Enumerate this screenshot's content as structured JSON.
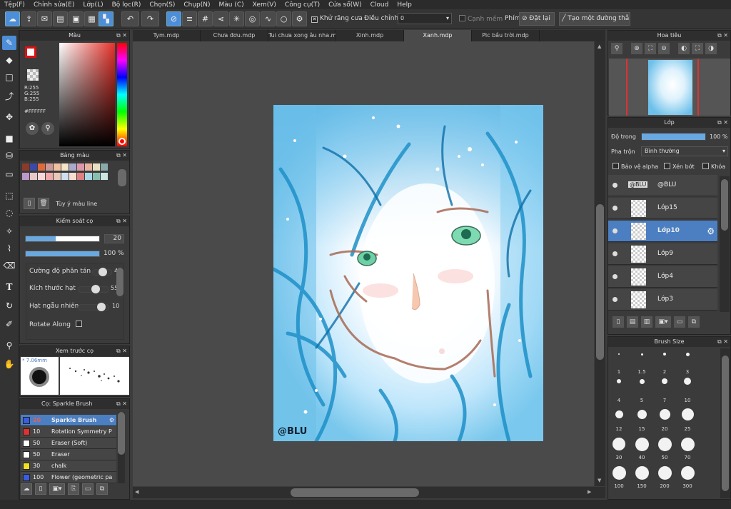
{
  "menu": [
    "Tệp(F)",
    "Chỉnh sửa(E)",
    "Lớp(L)",
    "Bộ lọc(R)",
    "Chọn(S)",
    "Chụp(N)",
    "Màu (C)",
    "Xem(V)",
    "Công cụ(T)",
    "Cửa sổ(W)",
    "Cloud",
    "Help"
  ],
  "toolbar": {
    "antialias_label": "Khử răng cưa",
    "adjust_label": "Điều chỉnh",
    "adjust_value": "0",
    "soft_edge_label": "Cạnh mềm",
    "key_label": "Phím",
    "reset_label": "Đặt lại",
    "create_line_label": "Tạo một đường thẳng"
  },
  "tabs": [
    "Tym.mdp",
    "Chưa đơu.mdp",
    "Tui chưa xong âu nha.mdp",
    "Xinh.mdp",
    "Xanh.mdp",
    "Pic bầu trời.mdp"
  ],
  "active_tab": 4,
  "color_panel": {
    "title": "Màu",
    "rgb_r": "R:255",
    "rgb_g": "G:255",
    "rgb_b": "B:255",
    "hex": "#FFFFFF"
  },
  "palette_panel": {
    "title": "Bảng màu",
    "custom_label": "Tùy ý màu line",
    "swatches": [
      "#8a3b2a",
      "#3b4aa8",
      "#e06a3a",
      "#c99",
      "#f0c0a0",
      "#f4e4c8",
      "#aac",
      "#d9a",
      "#e8b4a0",
      "#e8e0c0",
      "#8aa",
      "#b9c",
      "#e8c8c8",
      "#f8d8d8",
      "#f0a8a8",
      "#e8c8b8",
      "#d0e0f0",
      "#f8e0d0",
      "#e08080",
      "#a8d8e8",
      "#88c0b0",
      "#c8e8e0"
    ]
  },
  "brush_control": {
    "title": "Kiểm soát cọ",
    "size_value": "20",
    "opacity_value": "100 %",
    "scatter_label": "Cường độ phân tán",
    "scatter_value": "4",
    "particle_size_label": "Kích thước hạt",
    "particle_size_value": "55",
    "random_particle_label": "Hạt ngẫu nhiên",
    "random_particle_value": "10",
    "rotate_label": "Rotate Along"
  },
  "brush_preview": {
    "title": "Xem trước cọ",
    "size_label": "* 7.06mm"
  },
  "brush_list": {
    "title": "Cọ: Sparkle Brush",
    "items": [
      {
        "size": "20",
        "name": "Sparkle Brush",
        "color": "#3a5de0"
      },
      {
        "size": "10",
        "name": "Rotation Symmetry P",
        "color": "#e03030"
      },
      {
        "size": "50",
        "name": "Eraser (Soft)",
        "color": "#ffffff"
      },
      {
        "size": "50",
        "name": "Eraser",
        "color": "#ffffff"
      },
      {
        "size": "30",
        "name": "chalk",
        "color": "#f0e020"
      },
      {
        "size": "100",
        "name": "Flower (geometric pa",
        "color": "#3a5de0"
      }
    ]
  },
  "navigator": {
    "title": "Hoa tiêu"
  },
  "layer_panel": {
    "title": "Lớp",
    "opacity_label": "Độ trong",
    "opacity_value": "100 %",
    "blend_label": "Pha trộn",
    "blend_value": "Bình thường",
    "protect_alpha": "Bảo vệ alpha",
    "clipping": "Xén bớt",
    "lock": "Khóa",
    "layers": [
      {
        "name": "@BLU",
        "thumb": "@BLU"
      },
      {
        "name": "Lớp15"
      },
      {
        "name": "Lớp10"
      },
      {
        "name": "Lớp9"
      },
      {
        "name": "Lớp4"
      },
      {
        "name": "Lớp3"
      }
    ],
    "active_layer": 2
  },
  "brush_size_panel": {
    "title": "Brush Size",
    "sizes": [
      "1",
      "1.5",
      "2",
      "3",
      "4",
      "5",
      "7",
      "10",
      "12",
      "15",
      "20",
      "25",
      "30",
      "40",
      "50",
      "70",
      "100",
      "150",
      "200",
      "300"
    ]
  },
  "artwork": {
    "signature": "@BLU"
  }
}
